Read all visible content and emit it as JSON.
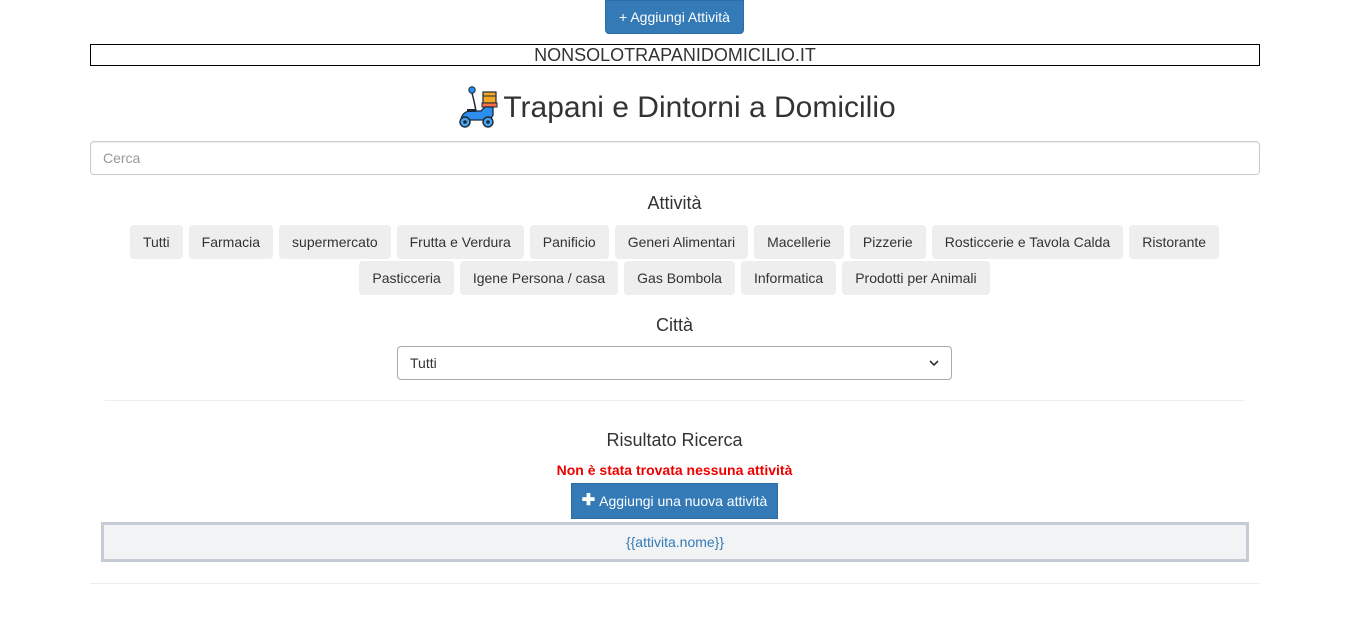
{
  "header": {
    "add_activity_label": "+ Aggiungi Attività",
    "brand": "NONSOLOTRAPANIDOMICILIO.IT",
    "title": "Trapani e Dintorni a Domicilio",
    "logo_icon": "delivery-scooter-icon"
  },
  "search": {
    "placeholder": "Cerca",
    "value": ""
  },
  "categories": {
    "heading": "Attività",
    "row1": [
      "Tutti",
      "Farmacia",
      "supermercato",
      "Frutta e Verdura",
      "Panificio",
      "Generi Alimentari",
      "Macellerie",
      "Pizzerie",
      "Rosticcerie e Tavola Calda",
      "Ristorante"
    ],
    "row2": [
      "Pasticceria",
      "Igene Persona / casa",
      "Gas Bombola",
      "Informatica",
      "Prodotti per Animali"
    ]
  },
  "city": {
    "heading": "Città",
    "selected": "Tutti"
  },
  "results": {
    "heading": "Risultato Ricerca",
    "no_results_text": "Non è stata trovata nessuna attività",
    "add_new_label": "Aggiungi una nuova attività",
    "item_placeholder": "{{attivita.nome}}"
  },
  "colors": {
    "primary": "#337ab7",
    "error": "#ee0000",
    "category_bg": "#eeeeee"
  }
}
